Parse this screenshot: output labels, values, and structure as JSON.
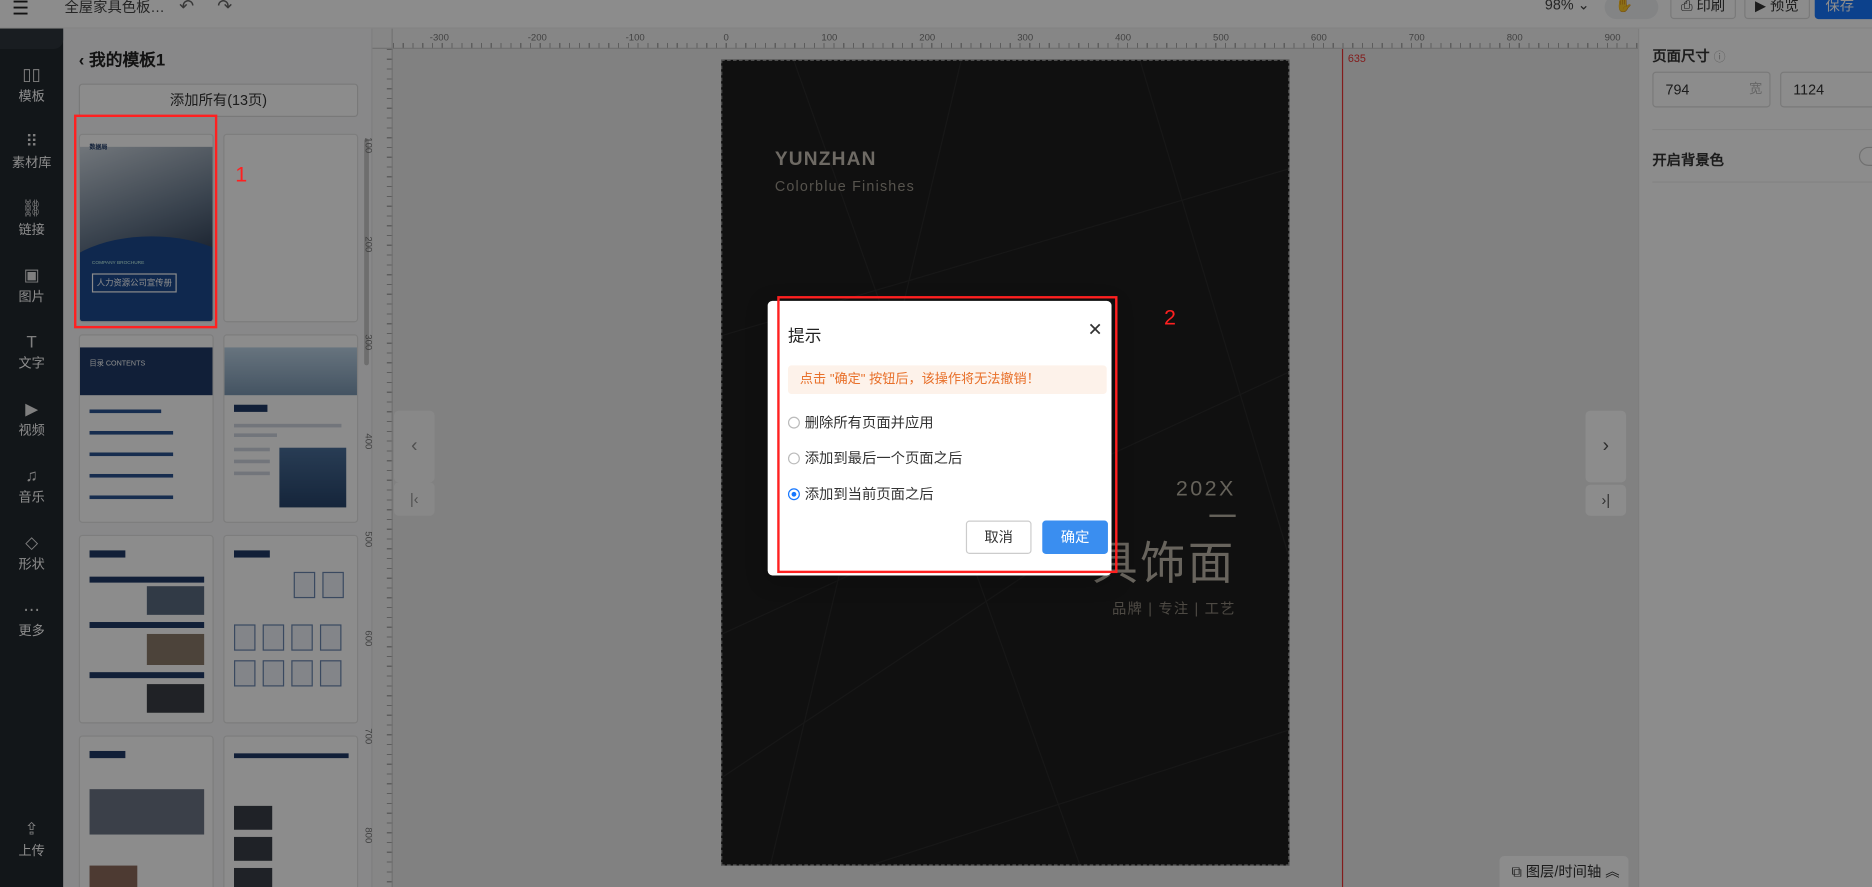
{
  "topbar": {
    "menu_icon": "hamburger-icon",
    "doc_title": "全屋家具色板…",
    "undo_icon": "undo-icon",
    "redo_icon": "redo-icon",
    "zoom": "98%",
    "hand_icon": "hand-icon",
    "print_label": "印刷",
    "preview_label": "预览",
    "save_label": "保存"
  },
  "leftnav": {
    "items": [
      {
        "icon": "template-icon",
        "glyph": "▯▯",
        "label": "模板"
      },
      {
        "icon": "assets-icon",
        "glyph": "⠿",
        "label": "素材库"
      },
      {
        "icon": "link-icon",
        "glyph": "🔗",
        "label": "链接"
      },
      {
        "icon": "image-icon",
        "glyph": "▣",
        "label": "图片"
      },
      {
        "icon": "text-icon",
        "glyph": "T",
        "label": "文字"
      },
      {
        "icon": "video-icon",
        "glyph": "▶",
        "label": "视频"
      },
      {
        "icon": "music-icon",
        "glyph": "♫",
        "label": "音乐"
      },
      {
        "icon": "shape-icon",
        "glyph": "◇",
        "label": "形状"
      },
      {
        "icon": "more-icon",
        "glyph": "⋯",
        "label": "更多"
      },
      {
        "icon": "upload-icon",
        "glyph": "⇪",
        "label": "上传"
      }
    ]
  },
  "templates": {
    "back_label": "我的模板1",
    "add_all_label": "添加所有(13页)",
    "thumb1": {
      "brand": "数据局",
      "caption": "人力资源公司宣传册",
      "sub": "COMPANY BROCHURE"
    },
    "thumb3_heading": "目录 CONTENTS"
  },
  "annotations": {
    "label1": "1",
    "label2": "2"
  },
  "canvas": {
    "ruler_h": [
      "-300",
      "-200",
      "-100",
      "0",
      "100",
      "200",
      "300",
      "400",
      "500",
      "600",
      "700",
      "800",
      "900"
    ],
    "ruler_v": [
      "100",
      "200",
      "300",
      "400",
      "500",
      "600",
      "700",
      "800"
    ],
    "guide_value": "635",
    "page": {
      "brand": "YUNZHAN",
      "brand_sub": "Colorblue Finishes",
      "year": "202X",
      "title": "具饰面",
      "tagline": "品牌 | 专注 | 工艺"
    },
    "layers_label": "图层/时间轴"
  },
  "rightpanel": {
    "page_size_label": "页面尺寸",
    "width_value": "794",
    "width_unit": "宽",
    "height_value": "1124",
    "bg_label": "开启背景色"
  },
  "dialog": {
    "title": "提示",
    "warning": "点击 \"确定\" 按钮后，该操作将无法撤销！",
    "options": [
      {
        "label": "删除所有页面并应用",
        "selected": false
      },
      {
        "label": "添加到最后一个页面之后",
        "selected": false
      },
      {
        "label": "添加到当前页面之后",
        "selected": true
      }
    ],
    "cancel_label": "取消",
    "ok_label": "确定"
  }
}
